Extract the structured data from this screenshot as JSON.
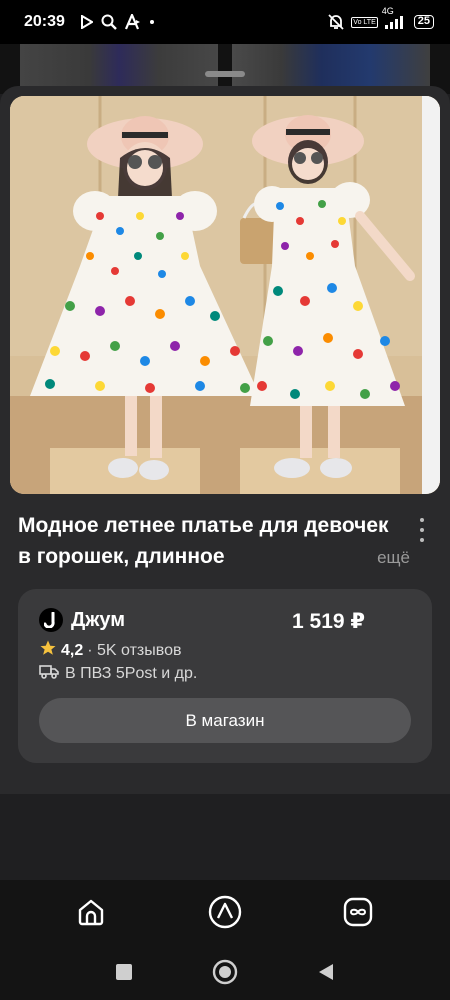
{
  "status_bar": {
    "time": "20:39",
    "network": "4G",
    "volte_label": "Vo LTE",
    "battery": "25",
    "icons": [
      "play-icon",
      "search-icon",
      "font-icon",
      "dot-icon",
      "mute-bell-icon",
      "signal-icon"
    ]
  },
  "product": {
    "image_alt": "Two girls in polka dot dresses and sun hats",
    "title": "Модное летнее платье для девочек в горошек, длинное",
    "more_label": "ещё"
  },
  "offer": {
    "shop_name": "Джум",
    "price": "1 519 ₽",
    "rating": "4,2",
    "reviews": "· 5K отзывов",
    "delivery": "В ПВЗ 5Post и др.",
    "store_button": "В магазин"
  },
  "app_nav": {
    "items": [
      "home-icon",
      "alice-icon",
      "infinity-icon"
    ]
  },
  "system_nav": {
    "items": [
      "recents-icon",
      "home-circle-icon",
      "back-icon"
    ]
  },
  "colors": {
    "sheet": "#2a2a2c",
    "card": "#3a3a3c",
    "button": "#555557",
    "star": "#f6c23e"
  }
}
